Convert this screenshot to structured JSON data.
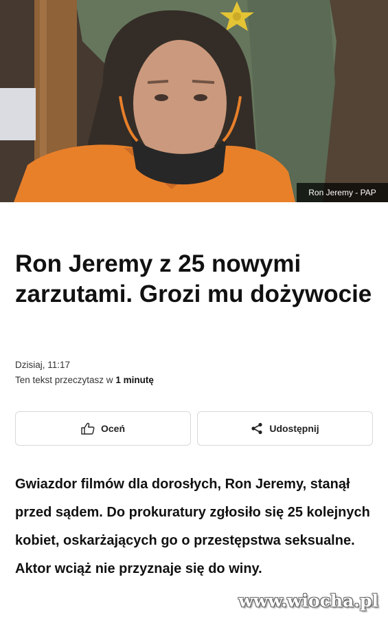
{
  "hero": {
    "caption": "Ron Jeremy - PAP"
  },
  "article": {
    "headline": "Ron Jeremy z 25 nowymi zarzutami. Grozi mu dożywocie",
    "date": "Dzisiaj, 11:17",
    "reading_time_prefix": "Ten tekst przeczytasz w ",
    "reading_time_value": "1 minutę",
    "lead": "Gwiazdor filmów dla dorosłych, Ron Jeremy, stanął przed sądem. Do prokuratury zgłosiło się 25 kolejnych kobiet, oskarżających go o przestępstwa seksualne. Aktor wciąż nie przyznaje się do winy."
  },
  "actions": {
    "rate_label": "Oceń",
    "share_label": "Udostępnij"
  },
  "watermark": {
    "text": "www.wiocha.pl"
  },
  "icons": {
    "rate": "thumbs-up-icon",
    "share": "share-icon"
  }
}
